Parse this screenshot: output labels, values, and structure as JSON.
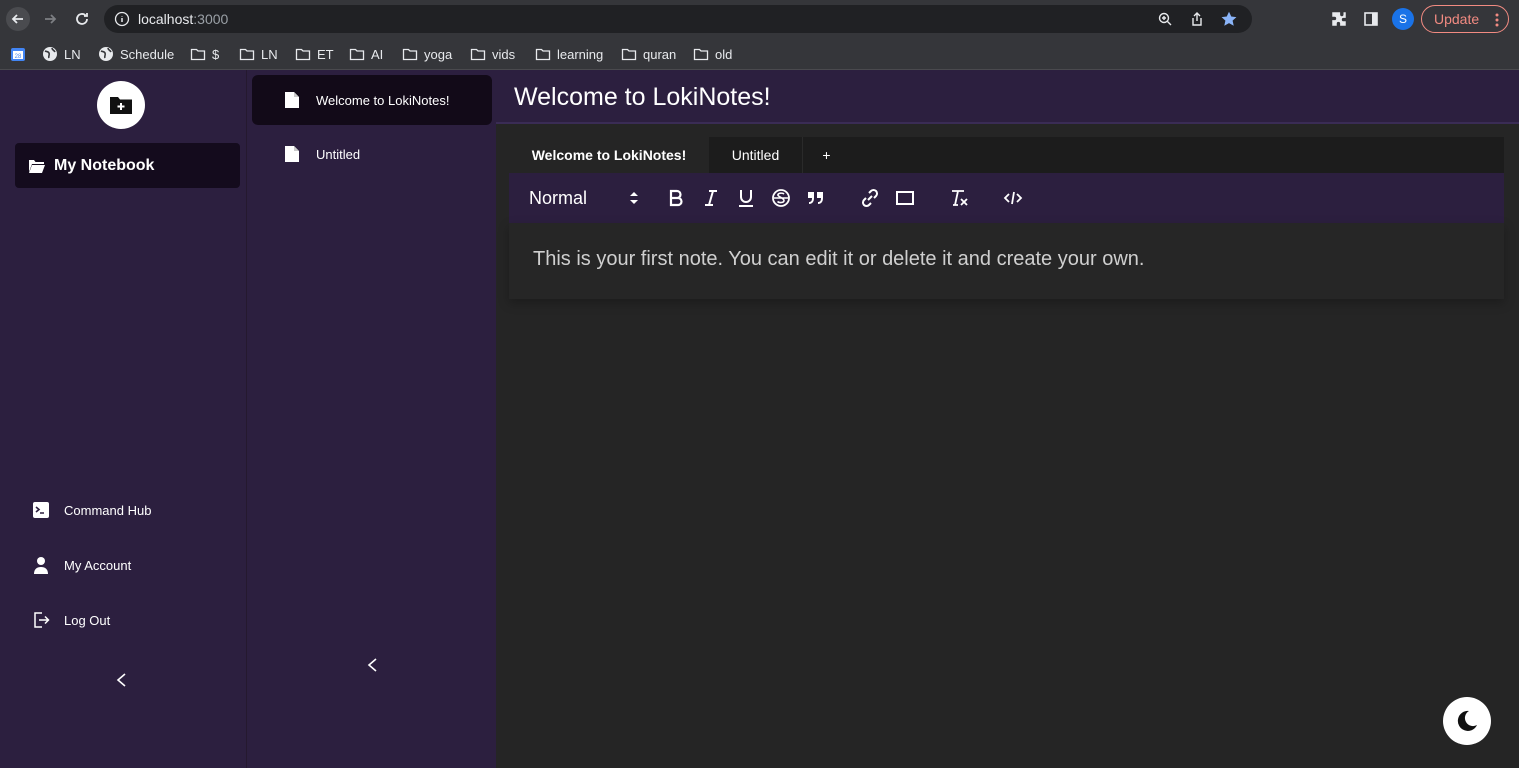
{
  "browser": {
    "url_host": "localhost",
    "url_port": ":3000",
    "update_label": "Update",
    "profile_initial": "S",
    "bookmarks": [
      {
        "label": "",
        "icon": "calendar-icon"
      },
      {
        "label": "LN",
        "icon": "globe-icon"
      },
      {
        "label": "Schedule",
        "icon": "globe-icon"
      },
      {
        "label": "$",
        "icon": "folder-icon"
      },
      {
        "label": "LN",
        "icon": "folder-icon"
      },
      {
        "label": "ET",
        "icon": "folder-icon"
      },
      {
        "label": "AI",
        "icon": "folder-icon"
      },
      {
        "label": "yoga",
        "icon": "folder-icon"
      },
      {
        "label": "vids",
        "icon": "folder-icon"
      },
      {
        "label": "learning",
        "icon": "folder-icon"
      },
      {
        "label": "quran",
        "icon": "folder-icon"
      },
      {
        "label": "old",
        "icon": "folder-icon"
      }
    ]
  },
  "sidebar": {
    "notebook_label": "My Notebook",
    "links": [
      {
        "label": "Command Hub",
        "icon": "terminal-icon"
      },
      {
        "label": "My Account",
        "icon": "user-icon"
      },
      {
        "label": "Log Out",
        "icon": "logout-icon"
      }
    ]
  },
  "notelist": {
    "notes": [
      {
        "title": "Welcome to LokiNotes!",
        "active": true
      },
      {
        "title": "Untitled",
        "active": false
      }
    ]
  },
  "main": {
    "title": "Welcome to LokiNotes!",
    "tabs": [
      {
        "label": "Welcome to LokiNotes!",
        "active": true
      },
      {
        "label": "Untitled",
        "active": false
      },
      {
        "label": "+",
        "active": false
      }
    ],
    "toolbar": {
      "format": "Normal",
      "tools": [
        "bold-icon",
        "italic-icon",
        "underline-icon",
        "strike-icon",
        "quote-icon",
        "link-icon",
        "image-icon",
        "clear-format-icon",
        "code-icon"
      ]
    },
    "editor_text": "This is your first note. You can edit it or delete it and create your own."
  },
  "colors": {
    "purple_bg": "#2c1f3f",
    "dark_item": "#140b1d",
    "editor_bg": "#252525"
  }
}
